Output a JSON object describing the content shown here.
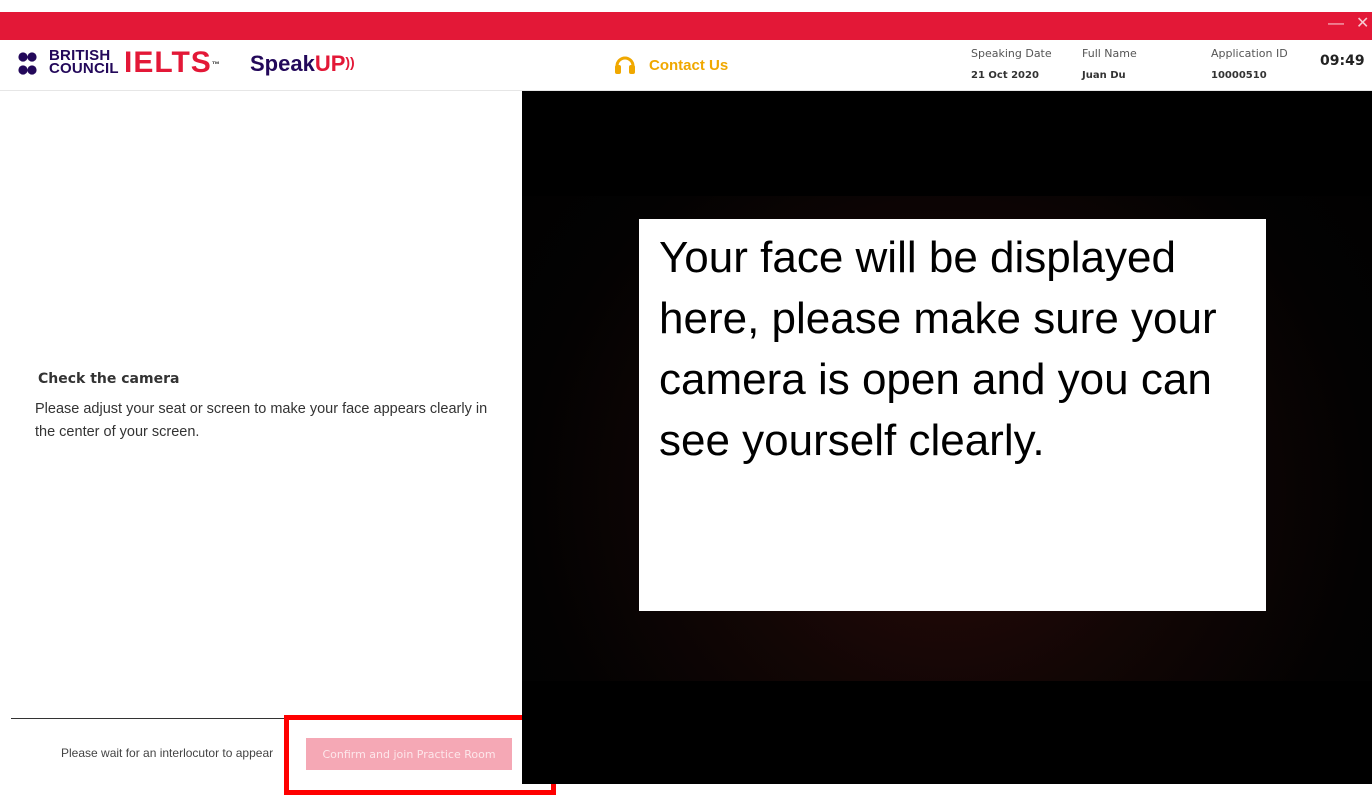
{
  "window": {
    "minimize_glyph": "—",
    "close_glyph": "✕"
  },
  "header": {
    "british_council": {
      "line1": "BRITISH",
      "line2": "COUNCIL"
    },
    "ielts": "IELTS",
    "ielts_tm": "™",
    "speakup_speak": "Speak",
    "speakup_up": "UP",
    "speakup_waves": "))",
    "contact_label": "Contact Us",
    "speaking_date_label": "Speaking Date",
    "speaking_date_value": "21 Oct 2020",
    "full_name_label": "Full Name",
    "full_name_value": "Juan Du",
    "application_id_label": "Application ID",
    "application_id_value": "10000510",
    "clock": "09:49"
  },
  "left_panel": {
    "check_title": "Check the camera",
    "check_description": "Please adjust your seat or screen to make your face appears clearly in the center of your screen.",
    "wait_text": "Please wait for an interlocutor to appear",
    "confirm_button": "Confirm and join Practice Room"
  },
  "video": {
    "notice": "Your face will be displayed here, please make sure your camera is open and you can see yourself clearly."
  },
  "colors": {
    "brand_red": "#e31837",
    "brand_navy": "#23085a",
    "contact_gold": "#f0a800",
    "highlight_red": "#ff0000",
    "disabled_button": "#f5a8b5"
  },
  "icons": {
    "headset": "headset-icon",
    "bc_dots": "british-council-dots-icon"
  }
}
